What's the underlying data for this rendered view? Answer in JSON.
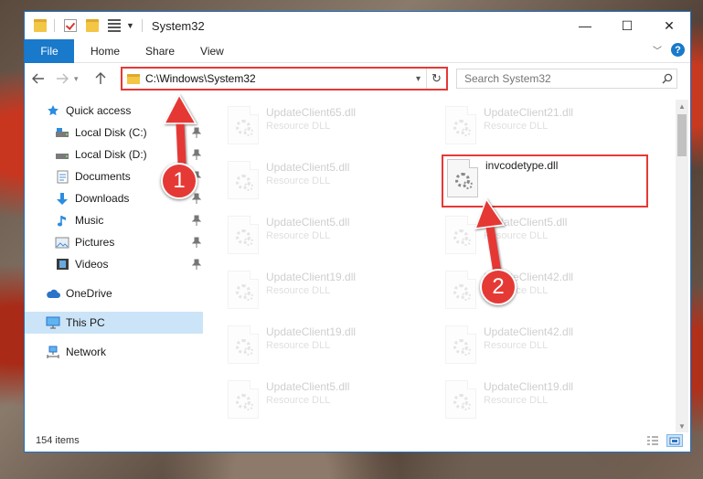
{
  "window": {
    "title": "System32",
    "controls": {
      "minimize": "—",
      "maximize": "☐",
      "close": "✕"
    }
  },
  "ribbon": {
    "tabs": [
      {
        "label": "File"
      },
      {
        "label": "Home"
      },
      {
        "label": "Share"
      },
      {
        "label": "View"
      }
    ]
  },
  "navigation": {
    "address": "C:\\Windows\\System32",
    "search_placeholder": "Search System32"
  },
  "sidebar": {
    "quick_access": "Quick access",
    "items": [
      {
        "label": "Local Disk (C:)",
        "pinned": true
      },
      {
        "label": "Local Disk (D:)",
        "pinned": true
      },
      {
        "label": "Documents",
        "pinned": true
      },
      {
        "label": "Downloads",
        "pinned": true
      },
      {
        "label": "Music",
        "pinned": true
      },
      {
        "label": "Pictures",
        "pinned": true
      },
      {
        "label": "Videos",
        "pinned": true
      }
    ],
    "onedrive": "OneDrive",
    "this_pc": "This PC",
    "network": "Network"
  },
  "files": {
    "left": [
      {
        "name": "UpdateClient65.dll",
        "type": "Resource DLL"
      },
      {
        "name": "UpdateClient5.dll",
        "type": "Resource DLL"
      },
      {
        "name": "UpdateClient5.dll",
        "type": "Resource DLL"
      },
      {
        "name": "UpdateClient19.dll",
        "type": "Resource DLL"
      },
      {
        "name": "UpdateClient19.dll",
        "type": "Resource DLL"
      },
      {
        "name": "UpdateClient5.dll",
        "type": "Resource DLL"
      }
    ],
    "right": [
      {
        "name": "UpdateClient21.dll",
        "type": "Resource DLL"
      },
      {
        "name": "invcodetype.dll",
        "type": ""
      },
      {
        "name": "UpdateClient5.dll",
        "type": "Resource DLL"
      },
      {
        "name": "UpdateClient42.dll",
        "type": "Resource DLL"
      },
      {
        "name": "UpdateClient42.dll",
        "type": "Resource DLL"
      },
      {
        "name": "UpdateClient19.dll",
        "type": "Resource DLL"
      }
    ]
  },
  "status": {
    "item_count": "154 items"
  },
  "annotations": {
    "badge_1": "1",
    "badge_2": "2"
  },
  "colors": {
    "accent": "#1979ca",
    "highlight": "#e53935",
    "selection": "#cce4f7"
  }
}
